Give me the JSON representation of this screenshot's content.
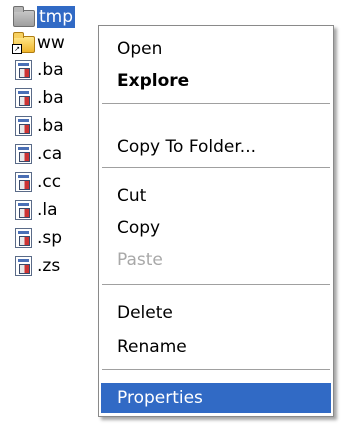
{
  "tree": {
    "items": [
      {
        "label": "tmp",
        "icon": "folder-icon",
        "selected": true
      },
      {
        "label": "ww",
        "icon": "shared-folder-icon"
      },
      {
        "label": ".ba",
        "icon": "file-icon"
      },
      {
        "label": ".ba",
        "icon": "file-icon"
      },
      {
        "label": ".ba",
        "icon": "file-icon"
      },
      {
        "label": ".ca",
        "icon": "file-icon"
      },
      {
        "label": ".cc",
        "icon": "file-icon"
      },
      {
        "label": ".la",
        "icon": "file-icon"
      },
      {
        "label": ".sp",
        "icon": "file-icon"
      },
      {
        "label": ".zs",
        "icon": "file-icon"
      }
    ]
  },
  "menu": {
    "open": "Open",
    "explore": "Explore",
    "copy_to_folder": "Copy To Folder...",
    "cut": "Cut",
    "copy": "Copy",
    "paste": "Paste",
    "delete": "Delete",
    "rename": "Rename",
    "properties": "Properties"
  },
  "colors": {
    "selection": "#316ac5",
    "disabled_text": "#a8a8a8"
  }
}
